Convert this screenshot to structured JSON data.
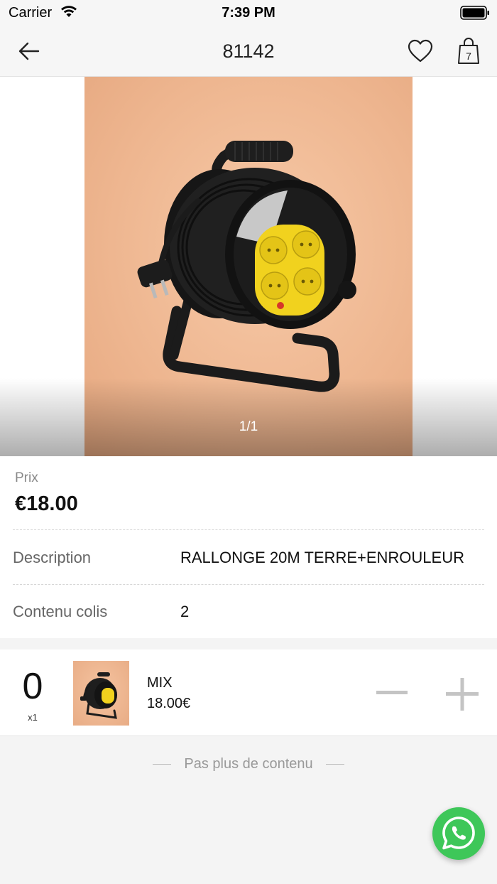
{
  "status_bar": {
    "carrier": "Carrier",
    "time": "7:39 PM"
  },
  "header": {
    "title": "81142",
    "back_icon": "arrow-left-icon",
    "favorite_icon": "heart-icon",
    "cart_icon": "shopping-bag-icon",
    "cart_count": "7"
  },
  "gallery": {
    "page_indicator": "1/1",
    "image": "cable-reel-extension-photo"
  },
  "product": {
    "price_label": "Prix",
    "price": "€18.00",
    "rows": [
      {
        "label": "Description",
        "value": "RALLONGE 20M TERRE+ENROULEUR"
      },
      {
        "label": "Contenu colis",
        "value": "2"
      }
    ]
  },
  "cart_item": {
    "quantity": "0",
    "multiplier": "x1",
    "variant": "MIX",
    "unit_price": "18.00€",
    "minus_icon": "minus-icon",
    "plus_icon": "plus-icon"
  },
  "footer": {
    "end_text": "Pas plus de contenu"
  },
  "fab": {
    "icon": "whatsapp-icon"
  },
  "colors": {
    "whatsapp_green": "#3ec759",
    "background": "#f4f4f4",
    "muted_text": "#888888"
  }
}
